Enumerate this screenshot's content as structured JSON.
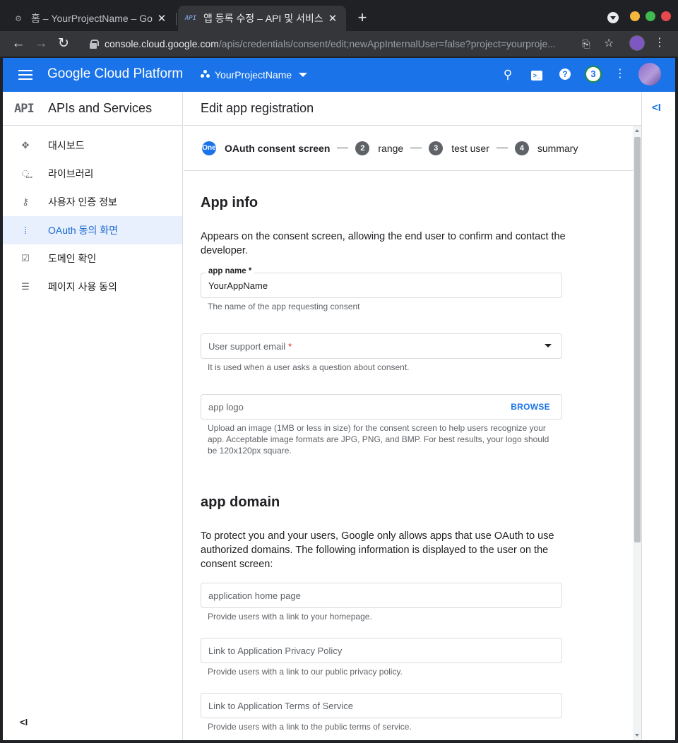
{
  "browser": {
    "tabs": [
      {
        "title": "홈 – YourProjectName – Go",
        "active": false,
        "favicon": "gear-icon"
      },
      {
        "title": "앱 등록 수정 – API 및 서비스",
        "active": true,
        "favicon": "api-icon",
        "favicon_text": "API"
      }
    ],
    "new_tab_label": "+",
    "url_host": "console.cloud.google.com",
    "url_path": "/apis/credentials/consent/edit;newAppInternalUser=false?project=yourproje..."
  },
  "header": {
    "brand": "Google Cloud Platform",
    "project_name": "YourProjectName",
    "notification_count": "3",
    "help_label": "?"
  },
  "sidebar": {
    "logo_text": "API",
    "title": "APIs and Services",
    "items": [
      {
        "label": "대시보드",
        "icon": "dashboard-icon",
        "active": false
      },
      {
        "label": "라이브러리",
        "icon": "library-icon",
        "active": false
      },
      {
        "label": "사용자 인증 정보",
        "icon": "key-icon",
        "active": false
      },
      {
        "label": "OAuth 동의 화면",
        "icon": "consent-icon",
        "active": true
      },
      {
        "label": "도메인 확인",
        "icon": "domain-check-icon",
        "active": false
      },
      {
        "label": "페이지 사용 동의",
        "icon": "page-settings-icon",
        "active": false
      }
    ],
    "collapse_label": "<I"
  },
  "content": {
    "title": "Edit app registration",
    "stepper": [
      {
        "num": "One",
        "label": "OAuth consent screen",
        "current": true
      },
      {
        "num": "2",
        "label": "range",
        "current": false
      },
      {
        "num": "3",
        "label": "test user",
        "current": false
      },
      {
        "num": "4",
        "label": "summary",
        "current": false
      }
    ],
    "app_info": {
      "title": "App info",
      "description": "Appears on the consent screen, allowing the end user to confirm and contact the developer.",
      "app_name": {
        "label": "app name *",
        "value": "YourAppName",
        "hint": "The name of the app requesting consent"
      },
      "support_email": {
        "placeholder": "User support email",
        "required_mark": "*",
        "hint": "It is used when a user asks a question about consent."
      },
      "logo": {
        "placeholder": "app logo",
        "button": "BROWSE",
        "hint": "Upload an image (1MB or less in size) for the consent screen to help users recognize your app. Acceptable image formats are JPG, PNG, and BMP. For best results, your logo should be 120x120px square."
      }
    },
    "app_domain": {
      "title": "app domain",
      "description": "To protect you and your users, Google only allows apps that use OAuth to use authorized domains. The following information is displayed to the user on the consent screen:",
      "home_page": {
        "placeholder": "application home page",
        "hint": "Provide users with a link to your homepage."
      },
      "privacy": {
        "placeholder": "Link to Application Privacy Policy",
        "hint": "Provide users with a link to our public privacy policy."
      },
      "terms": {
        "placeholder": "Link to Application Terms of Service",
        "hint": "Provide users with a link to the public terms of service."
      }
    }
  },
  "right_rail": {
    "toggle_label": "<I"
  },
  "colors": {
    "brand_blue": "#1a73e8",
    "active_nav_bg": "#e8f0fe",
    "required_red": "#d93025"
  }
}
